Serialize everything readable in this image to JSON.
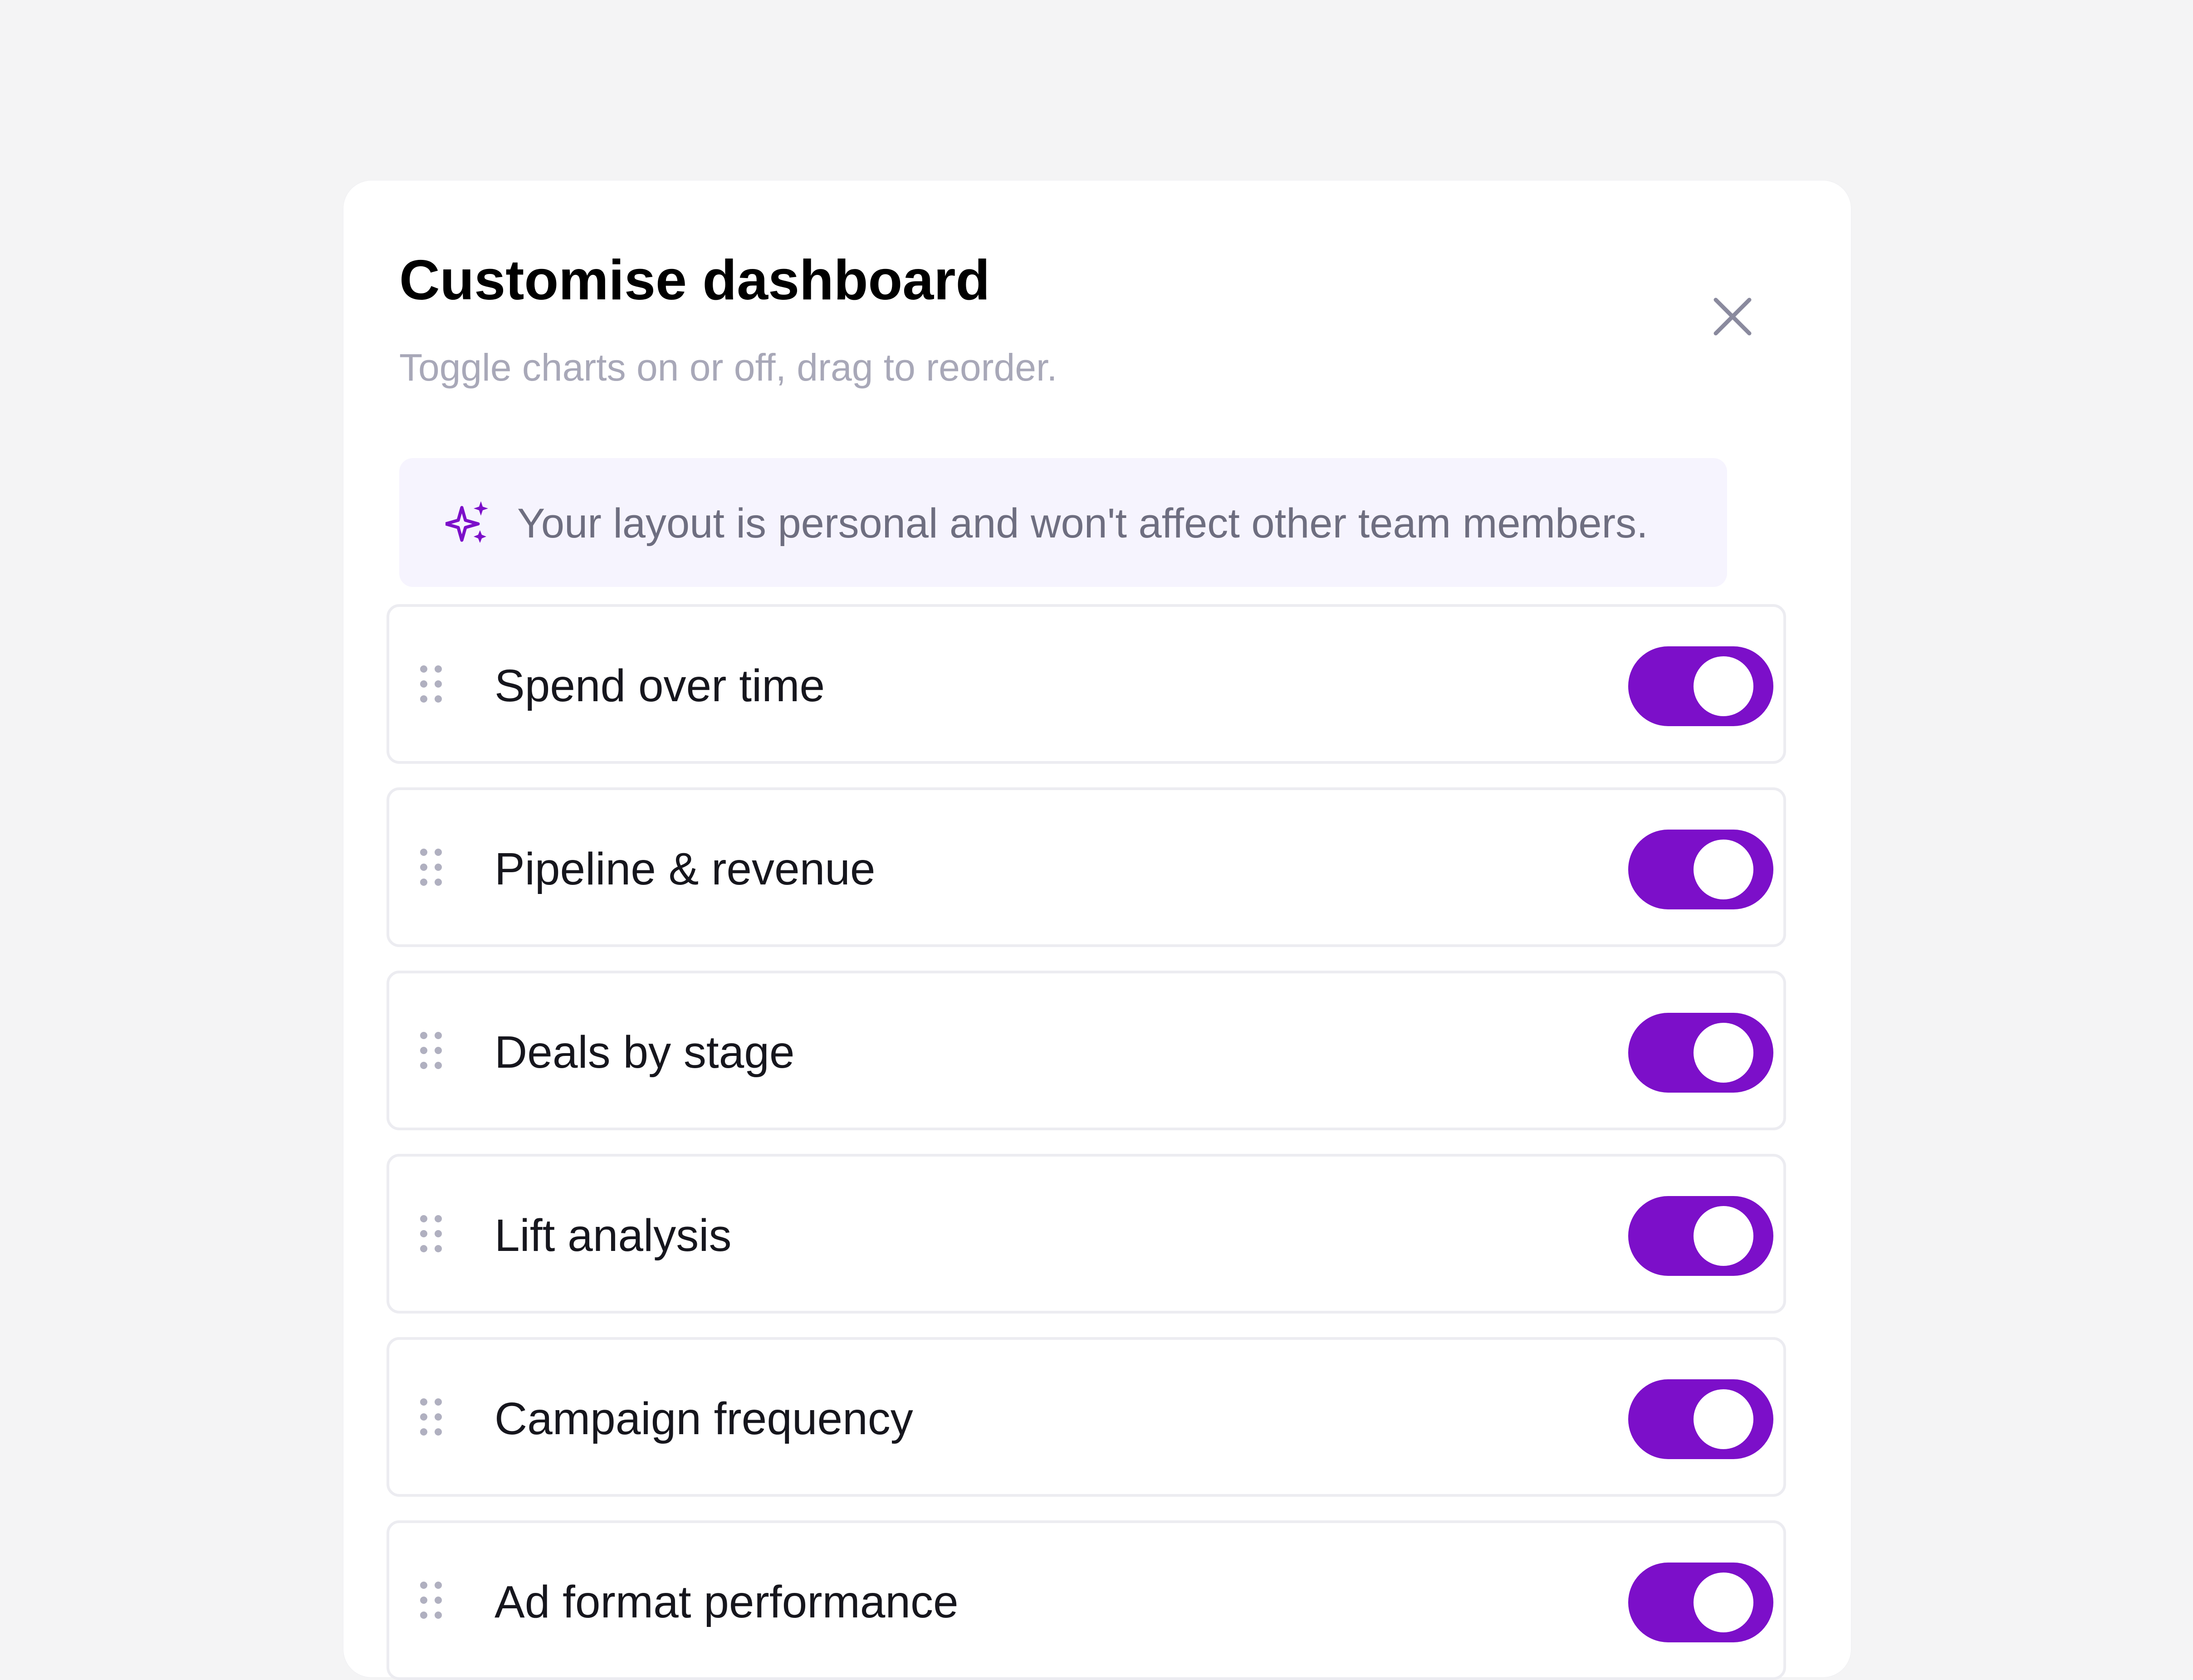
{
  "dialog": {
    "title": "Customise dashboard",
    "subtitle": "Toggle charts on or off, drag to reorder."
  },
  "banner": {
    "icon": "sparkle-icon",
    "text": "Your layout is personal and won't affect other team members."
  },
  "charts": [
    {
      "label": "Spend over time",
      "enabled": true
    },
    {
      "label": "Pipeline & revenue",
      "enabled": true
    },
    {
      "label": "Deals by stage",
      "enabled": true
    },
    {
      "label": "Lift analysis",
      "enabled": true
    },
    {
      "label": "Campaign frequency",
      "enabled": true
    },
    {
      "label": "Ad format performance",
      "enabled": true
    }
  ],
  "colors": {
    "accent": "#7c0fc9",
    "background": "#f4f4f5",
    "banner_bg": "#f6f4fe",
    "subtitle": "#a8a8b8"
  }
}
